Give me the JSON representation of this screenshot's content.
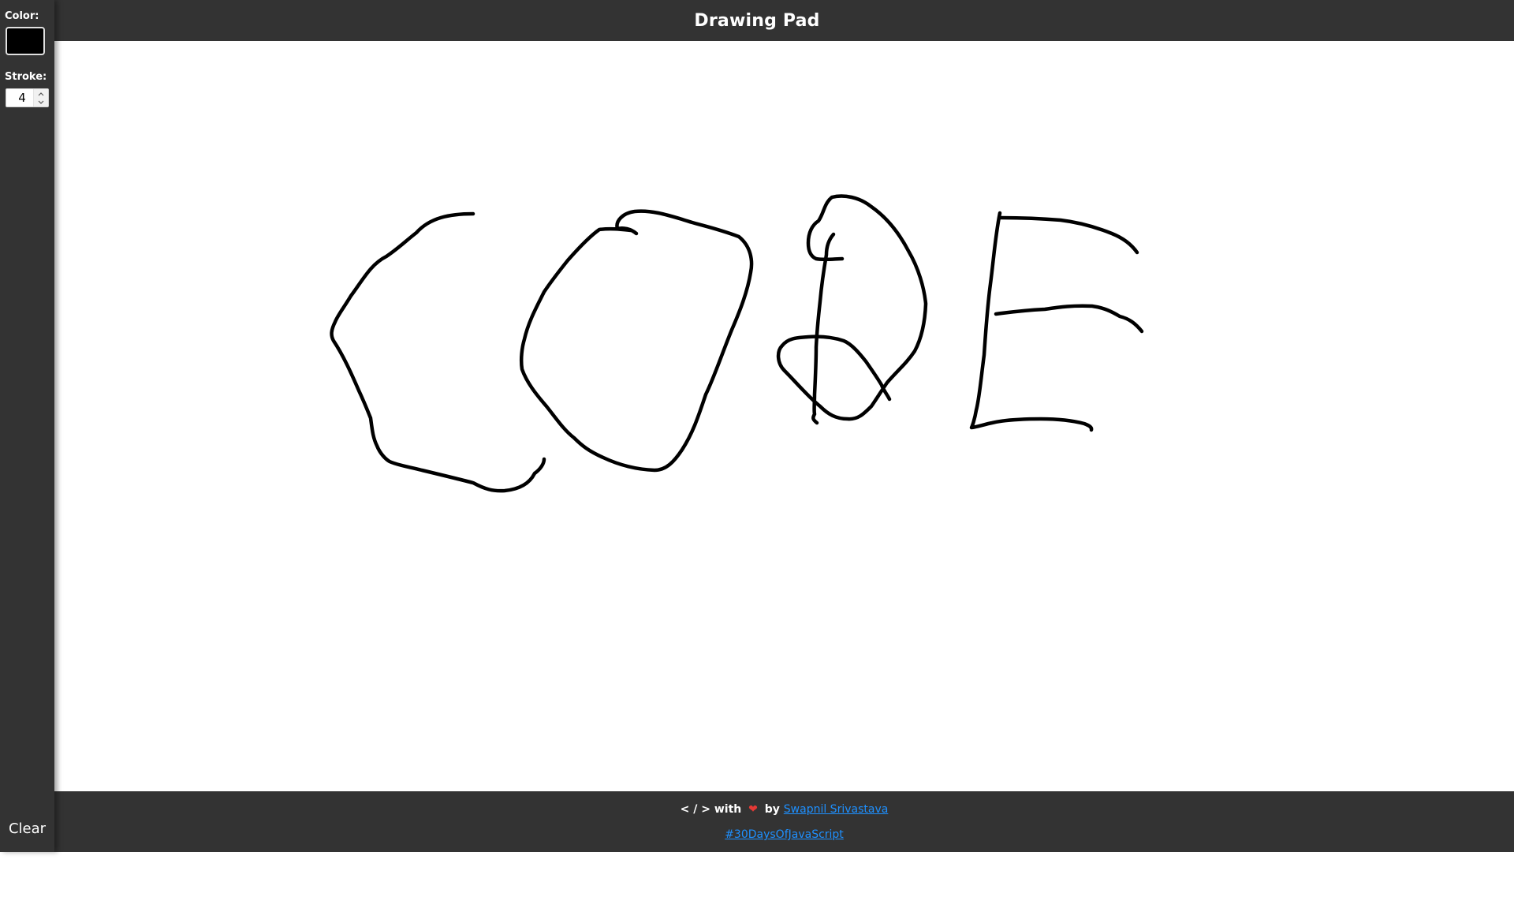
{
  "app": {
    "title": "Drawing Pad"
  },
  "sidebar": {
    "color_label": "Color:",
    "color_value": "#000000",
    "stroke_label": "Stroke:",
    "stroke_value": "4",
    "clear_label": "Clear"
  },
  "footer": {
    "line1_prefix": "< / > with",
    "heart_icon": "heart-icon",
    "by_label": "by",
    "author_link": "Swapnil Srivastava",
    "hashtag_link": "#30DaysOfJavaScript"
  },
  "colors": {
    "panel": "#333333",
    "canvas": "#ffffff",
    "stroke": "#000000",
    "link": "#1e90ff",
    "heart": "#e53935"
  }
}
